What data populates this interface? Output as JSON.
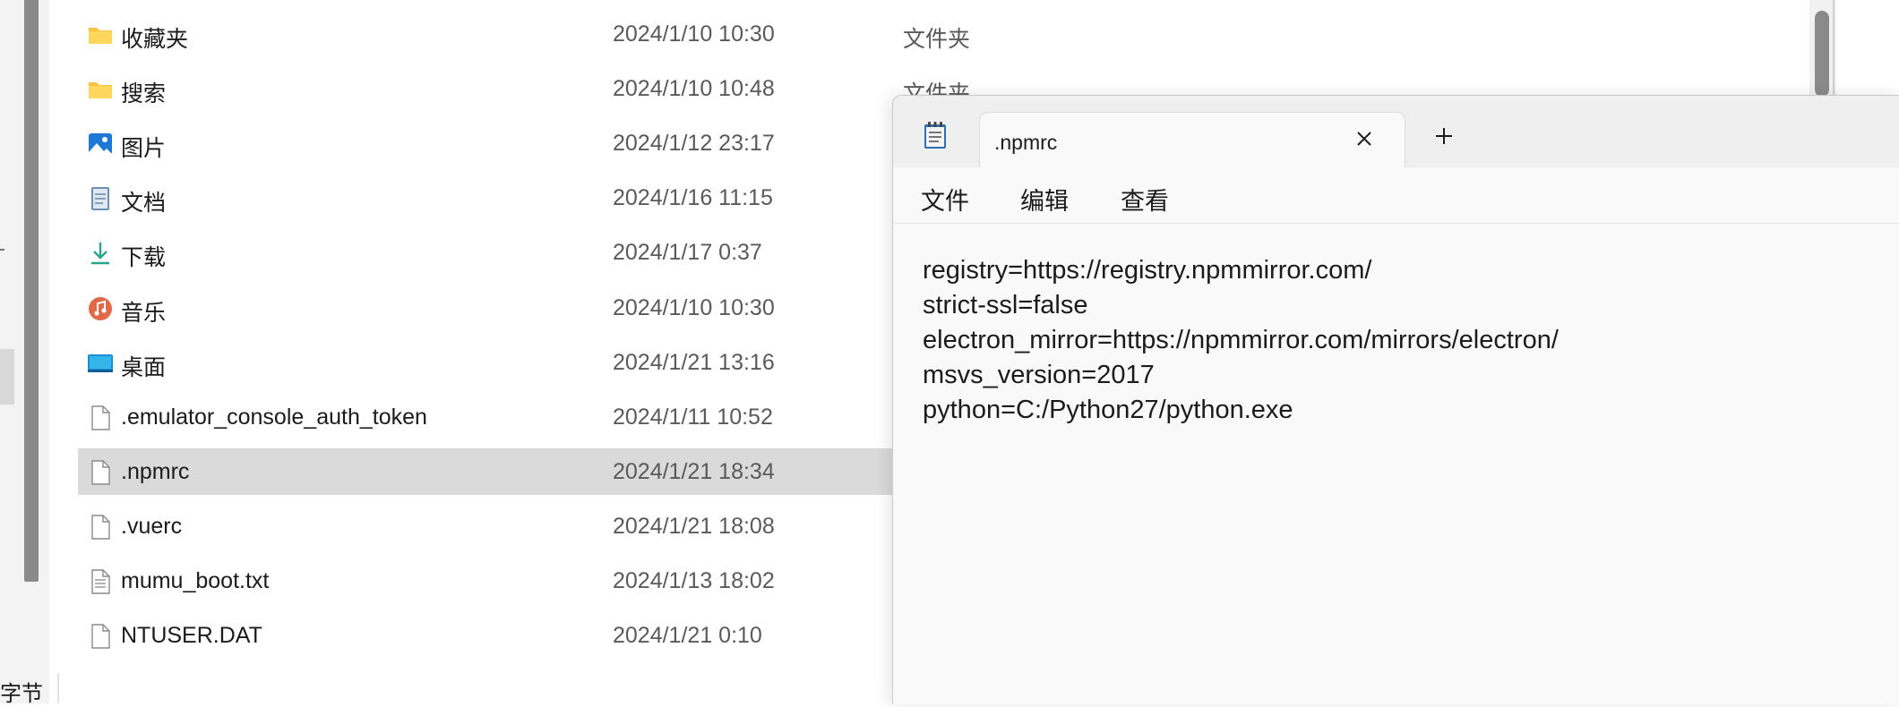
{
  "status_bar": {
    "text": "字节"
  },
  "files": [
    {
      "name": "收藏夹",
      "date": "2024/1/10 10:30",
      "type": "文件夹",
      "icon": "folder-icon"
    },
    {
      "name": "搜索",
      "date": "2024/1/10 10:48",
      "type": "文件夹",
      "icon": "folder-icon"
    },
    {
      "name": "图片",
      "date": "2024/1/12 23:17",
      "type": "",
      "icon": "pictures-icon"
    },
    {
      "name": "文档",
      "date": "2024/1/16 11:15",
      "type": "",
      "icon": "documents-icon"
    },
    {
      "name": "下载",
      "date": "2024/1/17 0:37",
      "type": "",
      "icon": "download-icon"
    },
    {
      "name": "音乐",
      "date": "2024/1/10 10:30",
      "type": "",
      "icon": "music-icon"
    },
    {
      "name": "桌面",
      "date": "2024/1/21 13:16",
      "type": "",
      "icon": "desktop-icon"
    },
    {
      "name": ".emulator_console_auth_token",
      "date": "2024/1/11 10:52",
      "type": "",
      "icon": "file-icon"
    },
    {
      "name": ".npmrc",
      "date": "2024/1/21 18:34",
      "type": "",
      "icon": "file-icon",
      "selected": true
    },
    {
      "name": ".vuerc",
      "date": "2024/1/21 18:08",
      "type": "",
      "icon": "file-icon"
    },
    {
      "name": "mumu_boot.txt",
      "date": "2024/1/13 18:02",
      "type": "",
      "icon": "text-file-icon"
    },
    {
      "name": "NTUSER.DAT",
      "date": "2024/1/21 0:10",
      "type": "",
      "icon": "file-icon"
    }
  ],
  "notepad": {
    "tab_title": ".npmrc",
    "menu": {
      "file": "文件",
      "edit": "编辑",
      "view": "查看"
    },
    "lines": [
      "registry=https://registry.npmmirror.com/",
      "strict-ssl=false",
      "electron_mirror=https://npmmirror.com/mirrors/electron/",
      "msvs_version=2017",
      "python=C:/Python27/python.exe"
    ]
  },
  "colors": {
    "folder": "#f6c342",
    "selection": "#dadada",
    "notepad_bg": "#f9f9f9",
    "tabbar_bg": "#efefef",
    "secondary_text": "#5a5a5a"
  }
}
